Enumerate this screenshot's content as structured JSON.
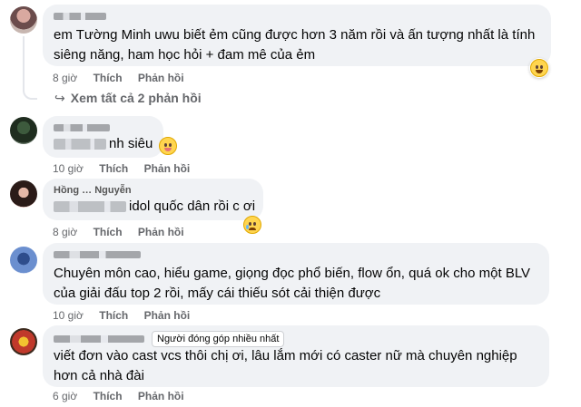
{
  "comments": [
    {
      "text": "em Tường Minh uwu biết ẻm cũng được hơn 3 năm rồi và ấn tượng nhất là tính siêng năng, ham học hỏi + đam mê của ẻm",
      "time": "8 giờ",
      "like": "Thích",
      "reply": "Phản hồi",
      "replies_link": "Xem tất cả 2 phản hồi",
      "reaction_icon": "grin-emoji-icon"
    },
    {
      "text": "nh siêu",
      "time": "10 giờ",
      "like": "Thích",
      "reply": "Phản hồi",
      "reaction_icon": "tongue-emoji-icon"
    },
    {
      "author_visible": "Hồng … Nguyễn",
      "text": "idol quốc dân rồi c ơi",
      "time": "8 giờ",
      "like": "Thích",
      "reply": "Phản hồi",
      "reaction_icon": "sad-emoji-icon"
    },
    {
      "text": "Chuyên môn cao, hiểu game, giọng đọc phổ biến, flow ổn, quá ok cho một BLV của giải đấu top 2 rồi, mấy cái thiếu sót cải thiện được",
      "time": "10 giờ",
      "like": "Thích",
      "reply": "Phản hồi"
    },
    {
      "badge": "Người đóng góp nhiều nhất",
      "text": "viết đơn vào cast vcs thôi chị ơi, lâu lắm mới có caster nữ mà chuyên nghiệp hơn cả nhà đài",
      "time": "6 giờ",
      "like": "Thích",
      "reply": "Phản hồi"
    }
  ],
  "colors": {
    "bubble": "#f0f2f5",
    "meta": "#65676b",
    "text": "#050505"
  }
}
